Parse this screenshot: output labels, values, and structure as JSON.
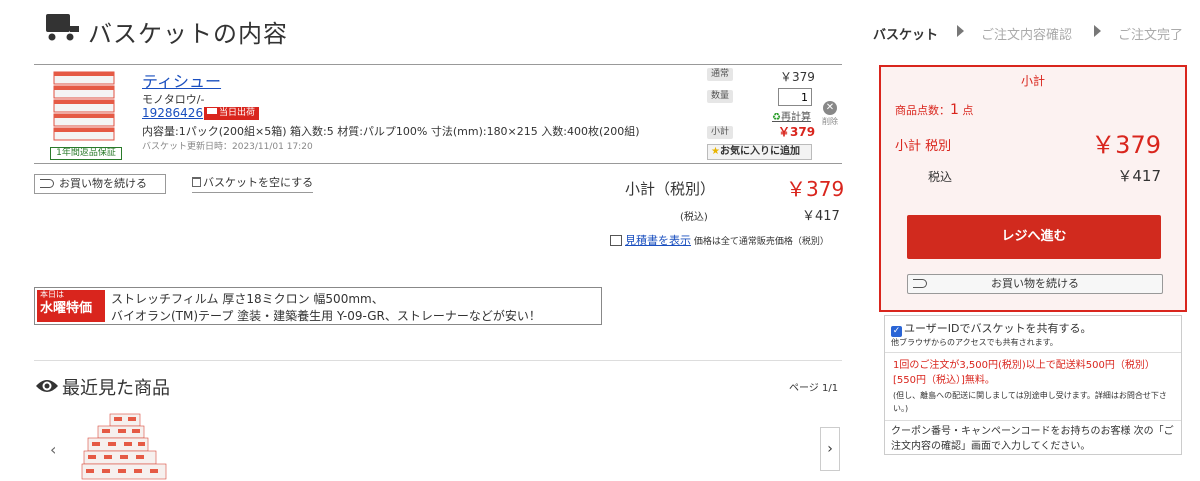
{
  "header": {
    "title": "バスケットの内容"
  },
  "steps": [
    {
      "label": "バスケット",
      "active": true
    },
    {
      "label": "ご注文内容確認",
      "active": false
    },
    {
      "label": "ご注文完了",
      "active": false
    }
  ],
  "item": {
    "name": "ティシュー",
    "brand": "モノタロウ/-",
    "code": "19286426",
    "badge_same_day": "当日出荷",
    "warranty": "1年間返品保証",
    "spec": "内容量:1パック(200組×5箱) 箱入数:5 材質:パルプ100% 寸法(mm):180×215 入数:400枚(200組)",
    "updated": "バスケット更新日時：2023/11/01 17:20",
    "regular_label": "通常",
    "regular_price": "￥379",
    "qty_label": "数量",
    "qty_value": "1",
    "recalc": "再計算",
    "subtotal_label": "小計",
    "subtotal": "￥379",
    "favorite": "お気に入りに追加",
    "delete": "削除"
  },
  "actions": {
    "continue_shopping": "お買い物を続ける",
    "empty_cart": "バスケットを空にする"
  },
  "summary": {
    "subtotal_label": "小計（税別）",
    "subtotal_value": "￥379",
    "tax_label": "(税込)",
    "tax_value": "￥417",
    "quote_link": "見積書を表示",
    "quote_note": "価格は全て通常販売価格（税別）"
  },
  "promo": {
    "tag_top": "本日は",
    "tag_bottom": "水曜特価",
    "line1": "ストレッチフィルム 厚さ18ミクロン 幅500mm、",
    "line2": "バイオラン(TM)テープ 塗装・建築養生用 Y-09-GR、ストレーナーなどが安い！"
  },
  "recent": {
    "title": "最近見た商品",
    "page": "ページ 1/1",
    "prev": "‹",
    "next": "›"
  },
  "panel": {
    "title": "小計",
    "count_label": "商品点数：",
    "count_value": "1",
    "count_unit": "点",
    "subtotal_label": "小計 税別",
    "subtotal_value": "￥379",
    "tax_label": "税込",
    "tax_value": "￥417",
    "checkout": "レジへ進む",
    "continue_shopping": "お買い物を続ける"
  },
  "info": {
    "share_label": "ユーザーIDでバスケットを共有する。",
    "share_checked": true,
    "share_note": "他ブラウザからのアクセスでも共有されます。",
    "shipping": "1回のご注文が3,500円(税別)以上で配送料500円（税別）[550円（税込）]無料。",
    "island": "(但し、離島への配送に関しましては別途申し受けます。詳細はお問合せ下さい。)",
    "coupon": "クーポン番号・キャンペーンコードをお持ちのお客様 次の「ご注文内容の確認」画面で入力してください。"
  },
  "colors": {
    "accent": "#d9251d",
    "link": "#1a4fbf",
    "panel_bg": "#fcf2f1"
  }
}
